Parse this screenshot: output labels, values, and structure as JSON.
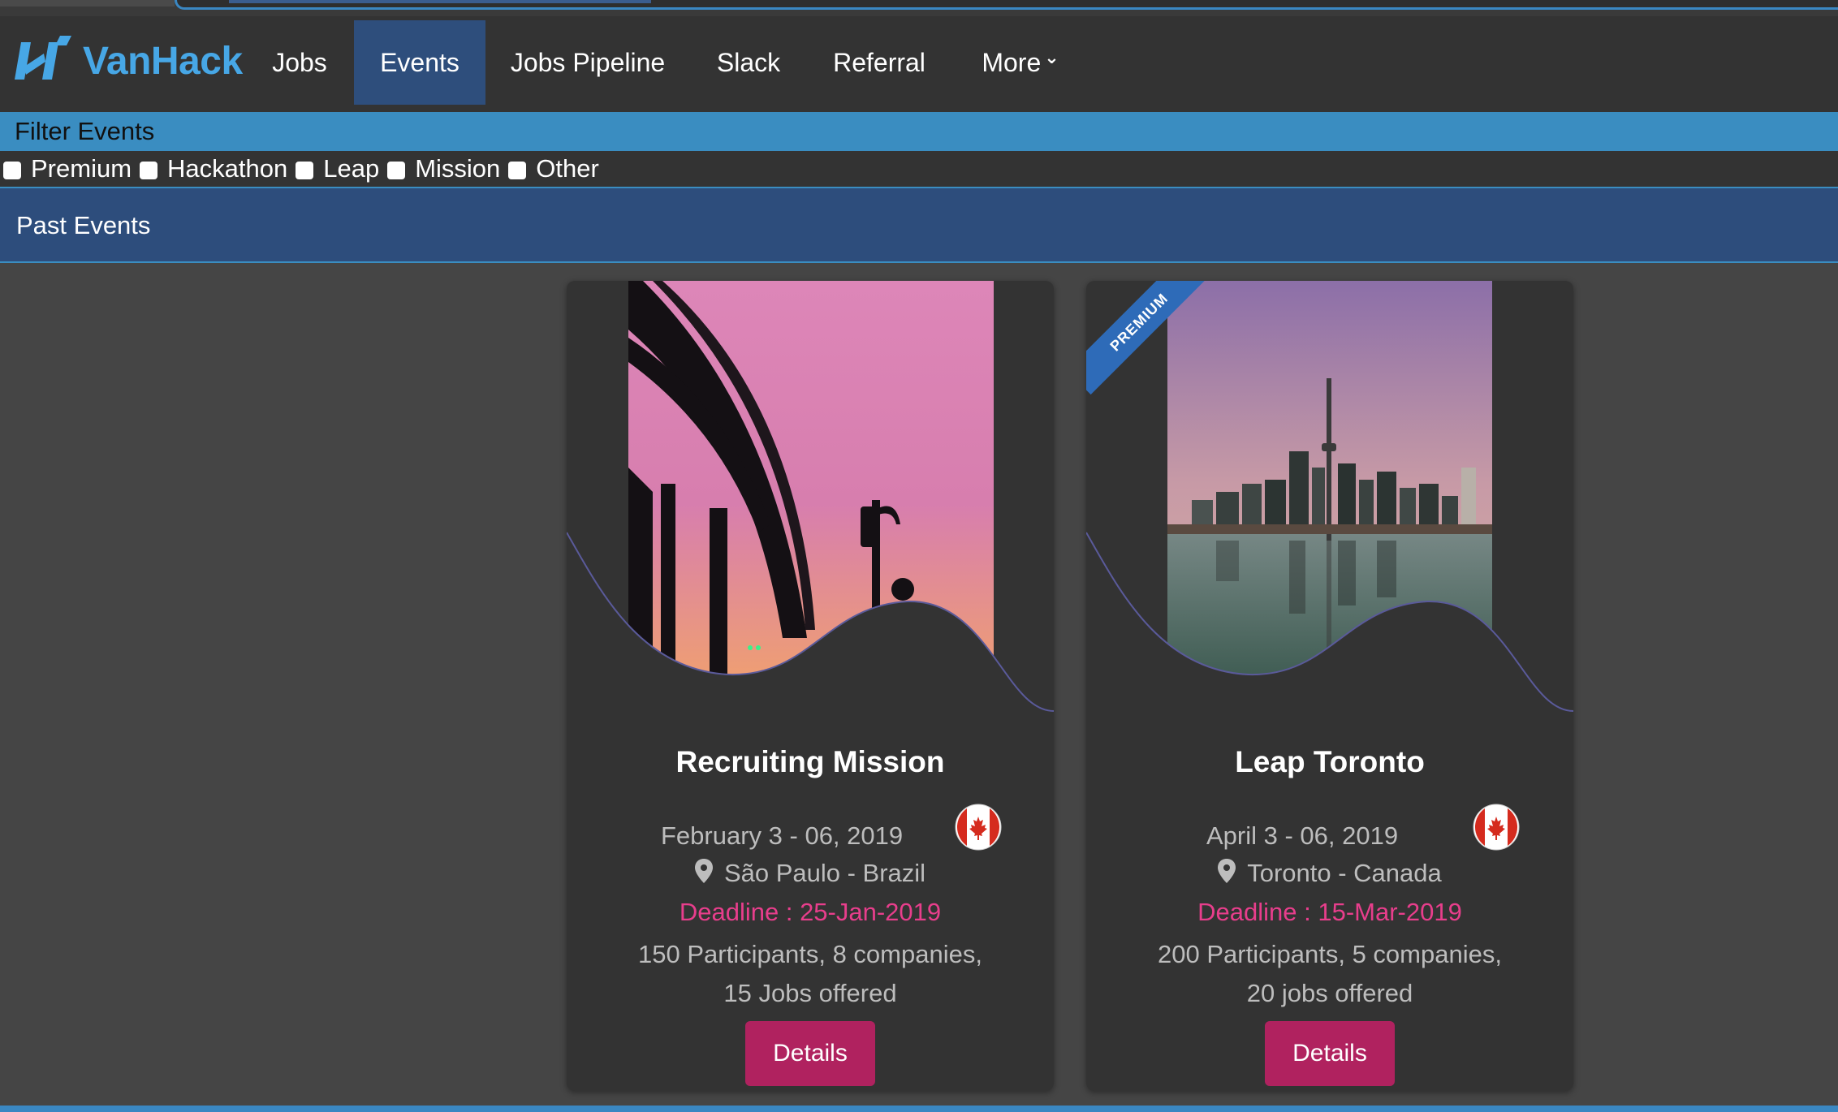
{
  "navbar": {
    "brand": "VanHack",
    "items": [
      {
        "label": "Jobs",
        "active": false
      },
      {
        "label": "Events",
        "active": true
      },
      {
        "label": "Jobs Pipeline",
        "active": false
      },
      {
        "label": "Slack",
        "active": false
      },
      {
        "label": "Referral",
        "active": false
      },
      {
        "label": "More",
        "active": false
      }
    ]
  },
  "filter": {
    "title": "Filter Events",
    "options": [
      {
        "label": "Premium",
        "checked": false
      },
      {
        "label": "Hackathon",
        "checked": false
      },
      {
        "label": "Leap",
        "checked": false
      },
      {
        "label": "Mission",
        "checked": false
      },
      {
        "label": "Other",
        "checked": false
      }
    ]
  },
  "past_events": {
    "title": "Past Events"
  },
  "events": [
    {
      "title": "Recruiting Mission",
      "date": "February 3 - 06, 2019",
      "location": "São Paulo - Brazil",
      "deadline": "Deadline : 25-Jan-2019",
      "stats_line1": "150 Participants, 8 companies,",
      "stats_line2": "15 Jobs offered",
      "button": "Details",
      "premium": false,
      "flag": "canada-flag-icon"
    },
    {
      "title": "Leap Toronto",
      "date": "April 3 - 06, 2019",
      "location": "Toronto - Canada",
      "deadline": "Deadline : 15-Mar-2019",
      "stats_line1": "200 Participants, 5 companies,",
      "stats_line2": "20 jobs offered",
      "button": "Details",
      "premium": true,
      "ribbon": "PREMIUM",
      "flag": "canada-flag-icon"
    }
  ],
  "colors": {
    "accent": "#3a8dc1",
    "nav_active": "#2e4e7c",
    "brand": "#47a7e6",
    "deadline": "#e83e8c",
    "button": "#b0225f"
  }
}
